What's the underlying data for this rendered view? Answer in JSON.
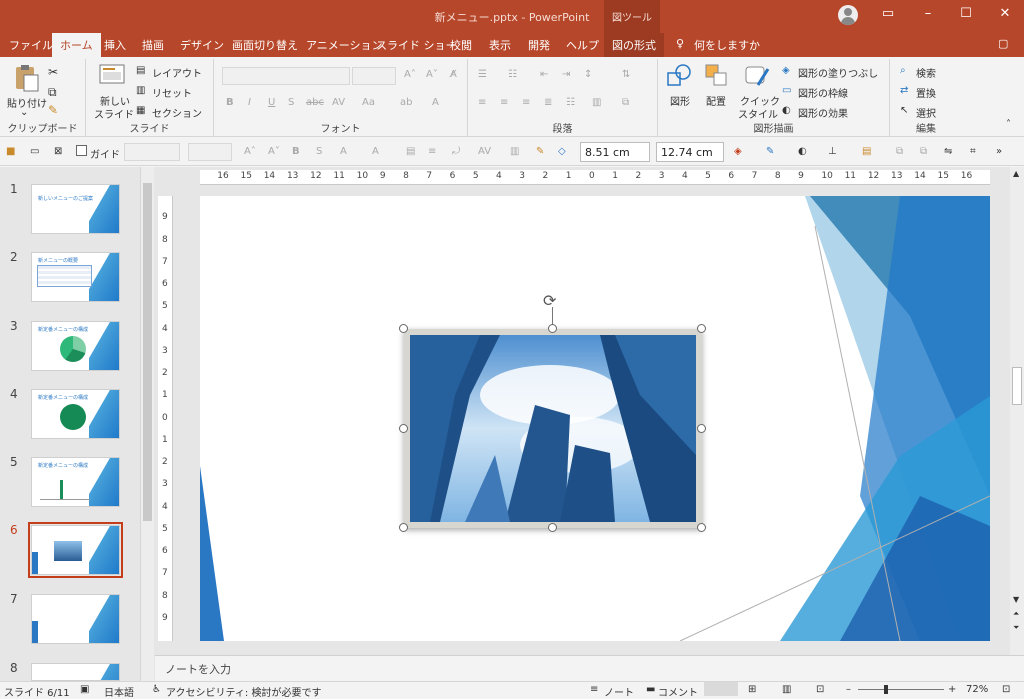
{
  "title": {
    "text": "新メニュー.pptx  -  PowerPoint",
    "tool_context": "図ツール"
  },
  "tabs": [
    "ファイル",
    "ホーム",
    "挿入",
    "描画",
    "デザイン",
    "画面切り替え",
    "アニメーション",
    "スライド ショー",
    "校閲",
    "表示",
    "開発",
    "ヘルプ",
    "図の形式",
    "何をしますか"
  ],
  "ribbon": {
    "clipboard": {
      "paste": "貼り付け",
      "group": "クリップボード"
    },
    "slides": {
      "new_slide": "新しい\nスライド",
      "new_slide_1": "新しい",
      "new_slide_2": "スライド",
      "layout": "レイアウト",
      "reset": "リセット",
      "section": "セクション",
      "group": "スライド"
    },
    "font": {
      "group": "フォント"
    },
    "paragraph": {
      "group": "段落"
    },
    "drawing": {
      "shape": "図形",
      "arrange": "配置",
      "quick_style_1": "クイック",
      "quick_style_2": "スタイル",
      "fill": "図形の塗りつぶし",
      "outline": "図形の枠線",
      "effect": "図形の効果",
      "group": "図形描画"
    },
    "editing": {
      "find": "検索",
      "replace": "置換",
      "select": "選択",
      "group": "編集"
    }
  },
  "qat": {
    "guide": "ガイド",
    "height": "8.51 cm",
    "width": "12.74 cm"
  },
  "slides": [
    {
      "num": "1",
      "title": "新しいメニューのご提案"
    },
    {
      "num": "2",
      "title": "新メニューの概要"
    },
    {
      "num": "3",
      "title": "新定番メニューの構成"
    },
    {
      "num": "4",
      "title": "新定番メニューの構成"
    },
    {
      "num": "5",
      "title": "新定番メニューの構成"
    },
    {
      "num": "6",
      "title": ""
    },
    {
      "num": "7",
      "title": ""
    },
    {
      "num": "8",
      "title": ""
    }
  ],
  "ruler_labels": [
    "16",
    "15",
    "14",
    "13",
    "12",
    "11",
    "10",
    "9",
    "8",
    "7",
    "6",
    "5",
    "4",
    "3",
    "2",
    "1",
    "0",
    "1",
    "2",
    "3",
    "4",
    "5",
    "6",
    "7",
    "8",
    "9",
    "10",
    "11",
    "12",
    "13",
    "14",
    "15",
    "16"
  ],
  "vruler_labels": [
    "9",
    "8",
    "7",
    "6",
    "5",
    "4",
    "3",
    "2",
    "1",
    "0",
    "1",
    "2",
    "3",
    "4",
    "5",
    "6",
    "7",
    "8",
    "9"
  ],
  "notes_placeholder": "ノートを入力",
  "status": {
    "slide": "スライド 6/11",
    "language": "日本語",
    "accessibility": "アクセシビリティ: 検討が必要です",
    "notes": "ノート",
    "comments": "コメント",
    "zoom": "72%"
  },
  "colors": {
    "accent": "#b7472a",
    "slide_blue": "#2a78c4"
  }
}
